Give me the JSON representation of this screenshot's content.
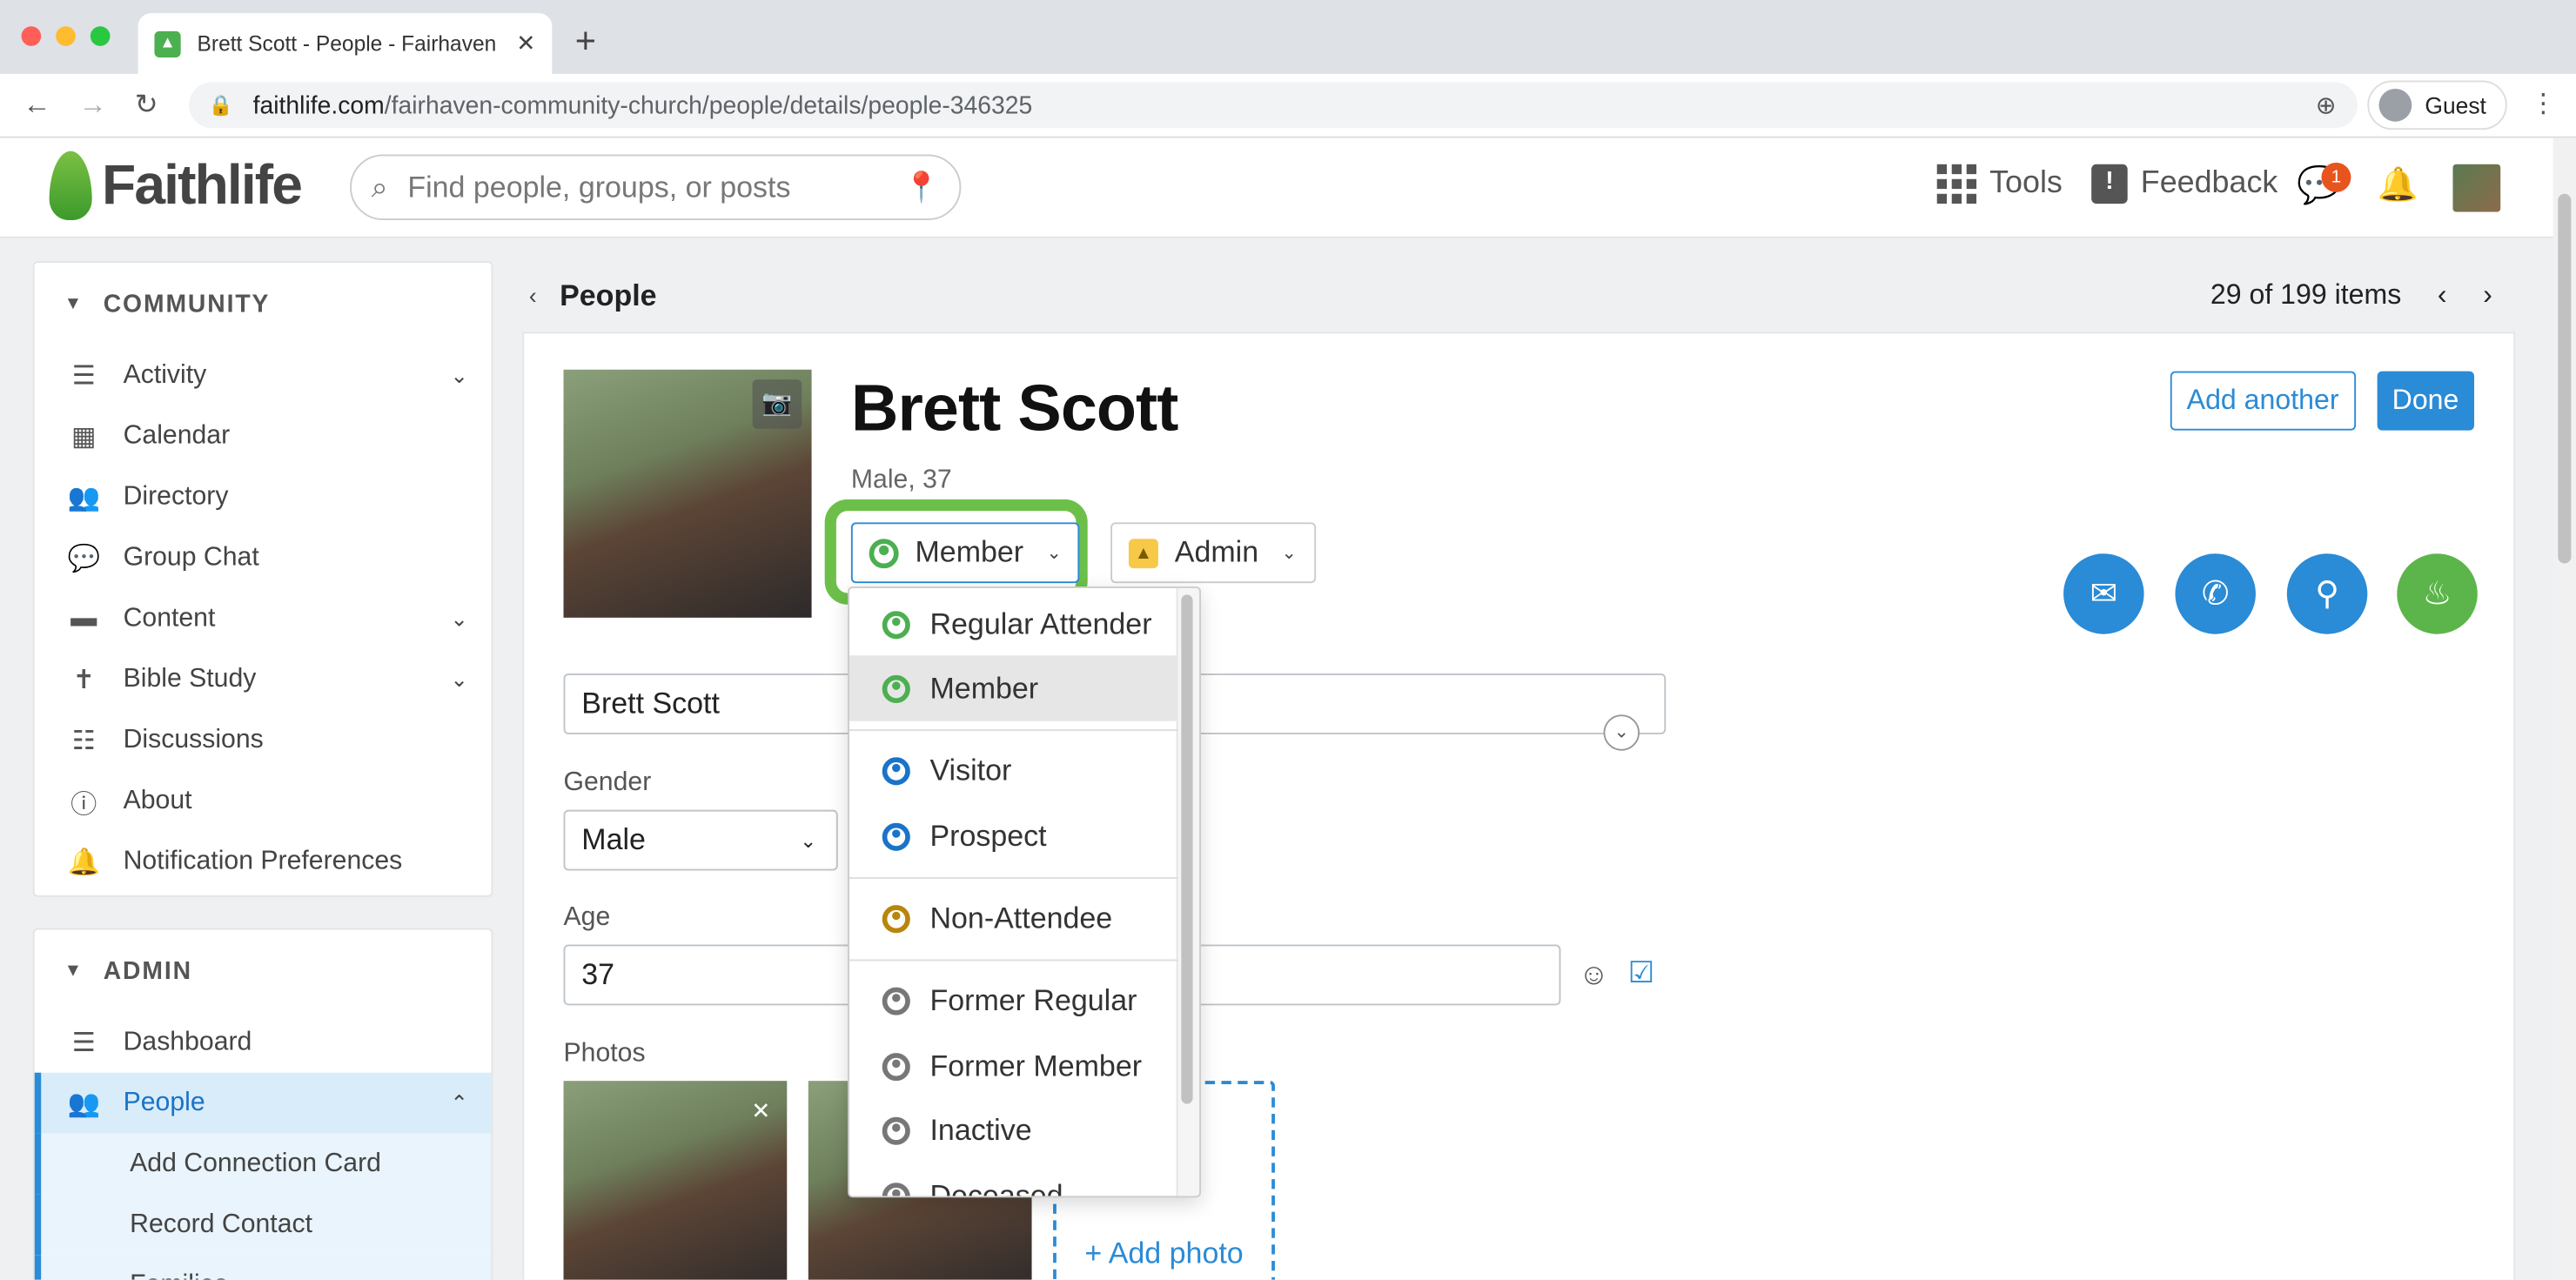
{
  "browser": {
    "tab_title": "Brett Scott - People - Fairhaven",
    "url_host": "faithlife.com",
    "url_path": "/fairhaven-community-church/people/details/people-346325",
    "profile_label": "Guest"
  },
  "header": {
    "logo_text": "Faithlife",
    "search_placeholder": "Find people, groups, or posts",
    "tools_label": "Tools",
    "feedback_label": "Feedback",
    "notification_count": "1"
  },
  "sidebar": {
    "community_heading": "COMMUNITY",
    "community_items": [
      {
        "label": "Activity",
        "icon": "activity-icon"
      },
      {
        "label": "Calendar",
        "icon": "calendar-icon"
      },
      {
        "label": "Directory",
        "icon": "directory-icon"
      },
      {
        "label": "Group Chat",
        "icon": "chat-icon"
      },
      {
        "label": "Content",
        "icon": "folder-icon"
      },
      {
        "label": "Bible Study",
        "icon": "bible-icon"
      },
      {
        "label": "Discussions",
        "icon": "discussions-icon"
      },
      {
        "label": "About",
        "icon": "info-icon"
      },
      {
        "label": "Notification Preferences",
        "icon": "bell-icon"
      }
    ],
    "admin_heading": "ADMIN",
    "admin_items": [
      {
        "label": "Dashboard",
        "icon": "dashboard-icon"
      },
      {
        "label": "People",
        "icon": "people-icon"
      }
    ],
    "people_subitems": [
      "Add Connection Card",
      "Record Contact",
      "Families"
    ]
  },
  "main": {
    "breadcrumb": "People",
    "pager_text": "29 of 199 items",
    "person_name": "Brett Scott",
    "person_sub": "Male, 37",
    "add_another_label": "Add another",
    "done_label": "Done",
    "status_label": "Member",
    "role_label": "Admin",
    "name_field_value": "Brett Scott",
    "gender_label": "Gender",
    "gender_value": "Male",
    "age_label": "Age",
    "age_value": "37",
    "photos_label": "Photos",
    "add_photo_label": "+ Add photo",
    "contact_colors": {
      "email": "#2a8bd6",
      "phone": "#2a8bd6",
      "location": "#2a8bd6",
      "faithlife": "#5cb54a"
    }
  },
  "status_dropdown": {
    "options": [
      {
        "label": "Regular Attender",
        "color": "#4caf50"
      },
      {
        "label": "Member",
        "color": "#4caf50",
        "selected": true
      },
      {
        "label": "Visitor",
        "color": "#1a73c9"
      },
      {
        "label": "Prospect",
        "color": "#1a73c9"
      },
      {
        "label": "Non-Attendee",
        "color": "#b8860b"
      },
      {
        "label": "Former Regular",
        "color": "#777777"
      },
      {
        "label": "Former Member",
        "color": "#777777"
      },
      {
        "label": "Inactive",
        "color": "#777777"
      },
      {
        "label": "Deceased",
        "color": "#777777"
      }
    ]
  },
  "colors": {
    "accent": "#2a8bd6",
    "highlight_green": "#6cc04a"
  }
}
